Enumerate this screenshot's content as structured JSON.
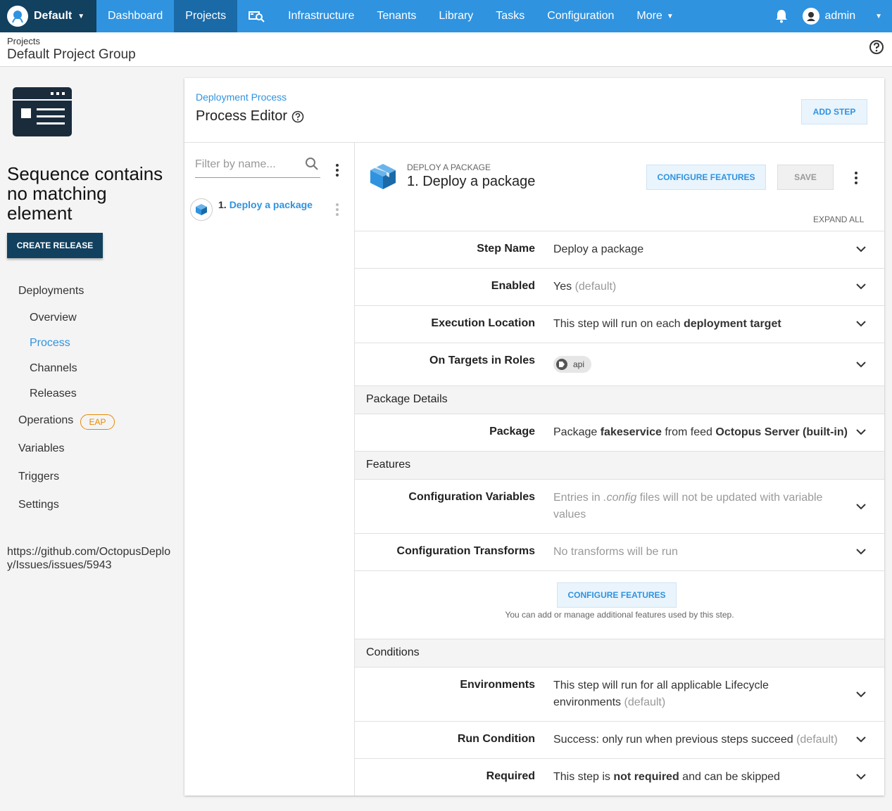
{
  "nav": {
    "space": "Default",
    "items": [
      "Dashboard",
      "Projects",
      "Infrastructure",
      "Tenants",
      "Library",
      "Tasks",
      "Configuration"
    ],
    "more": "More",
    "user": "admin"
  },
  "header": {
    "breadcrumb": "Projects",
    "project_group": "Default Project Group"
  },
  "sidebar": {
    "error": "Sequence contains no matching element",
    "create_release": "CREATE RELEASE",
    "deployments": "Deployments",
    "sub": [
      "Overview",
      "Process",
      "Channels",
      "Releases"
    ],
    "operations": "Operations",
    "eap": "EAP",
    "variables": "Variables",
    "triggers": "Triggers",
    "settings": "Settings",
    "link": "https://github.com/OctopusDeploy/Issues/issues/5943"
  },
  "editor": {
    "breadcrumb": "Deployment Process",
    "title": "Process Editor",
    "add_step": "ADD STEP",
    "filter_placeholder": "Filter by name...",
    "step_num": "1.",
    "step_name": "Deploy a package"
  },
  "step": {
    "kind": "DEPLOY A PACKAGE",
    "title": "1.  Deploy a package",
    "configure_features": "CONFIGURE FEATURES",
    "save": "SAVE",
    "expand_all": "EXPAND ALL",
    "step_name_label": "Step Name",
    "step_name_value": "Deploy a package",
    "enabled_label": "Enabled",
    "enabled_value": "Yes",
    "default": "(default)",
    "exec_label": "Execution Location",
    "exec_value_a": "This step will run on each",
    "exec_value_b": "deployment target",
    "roles_label": "On Targets in Roles",
    "role": "api",
    "package_details": "Package Details",
    "package_label": "Package",
    "package_a": "Package",
    "package_name": "fakeservice",
    "package_b": "from feed",
    "package_feed": "Octopus Server (built-in)",
    "features": "Features",
    "cfgvars_label": "Configuration Variables",
    "cfgvars_a": "Entries in",
    "cfgvars_ext": ".config",
    "cfgvars_b": "files will not be updated with variable values",
    "cfgtrans_label": "Configuration Transforms",
    "cfgtrans_value": "No transforms will be run",
    "features_note": "You can add or manage additional features used by this step.",
    "conditions": "Conditions",
    "env_label": "Environments",
    "env_value": "This step will run for all applicable Lifecycle environments",
    "run_label": "Run Condition",
    "run_value": "Success: only run when previous steps succeed",
    "req_label": "Required",
    "req_a": "This step is",
    "req_b": "not required",
    "req_c": "and can be skipped"
  },
  "colors": {
    "nav": "#2f93e0",
    "nav_dark": "#12405f",
    "accent": "#2f93e0",
    "eap": "#e68a00"
  }
}
